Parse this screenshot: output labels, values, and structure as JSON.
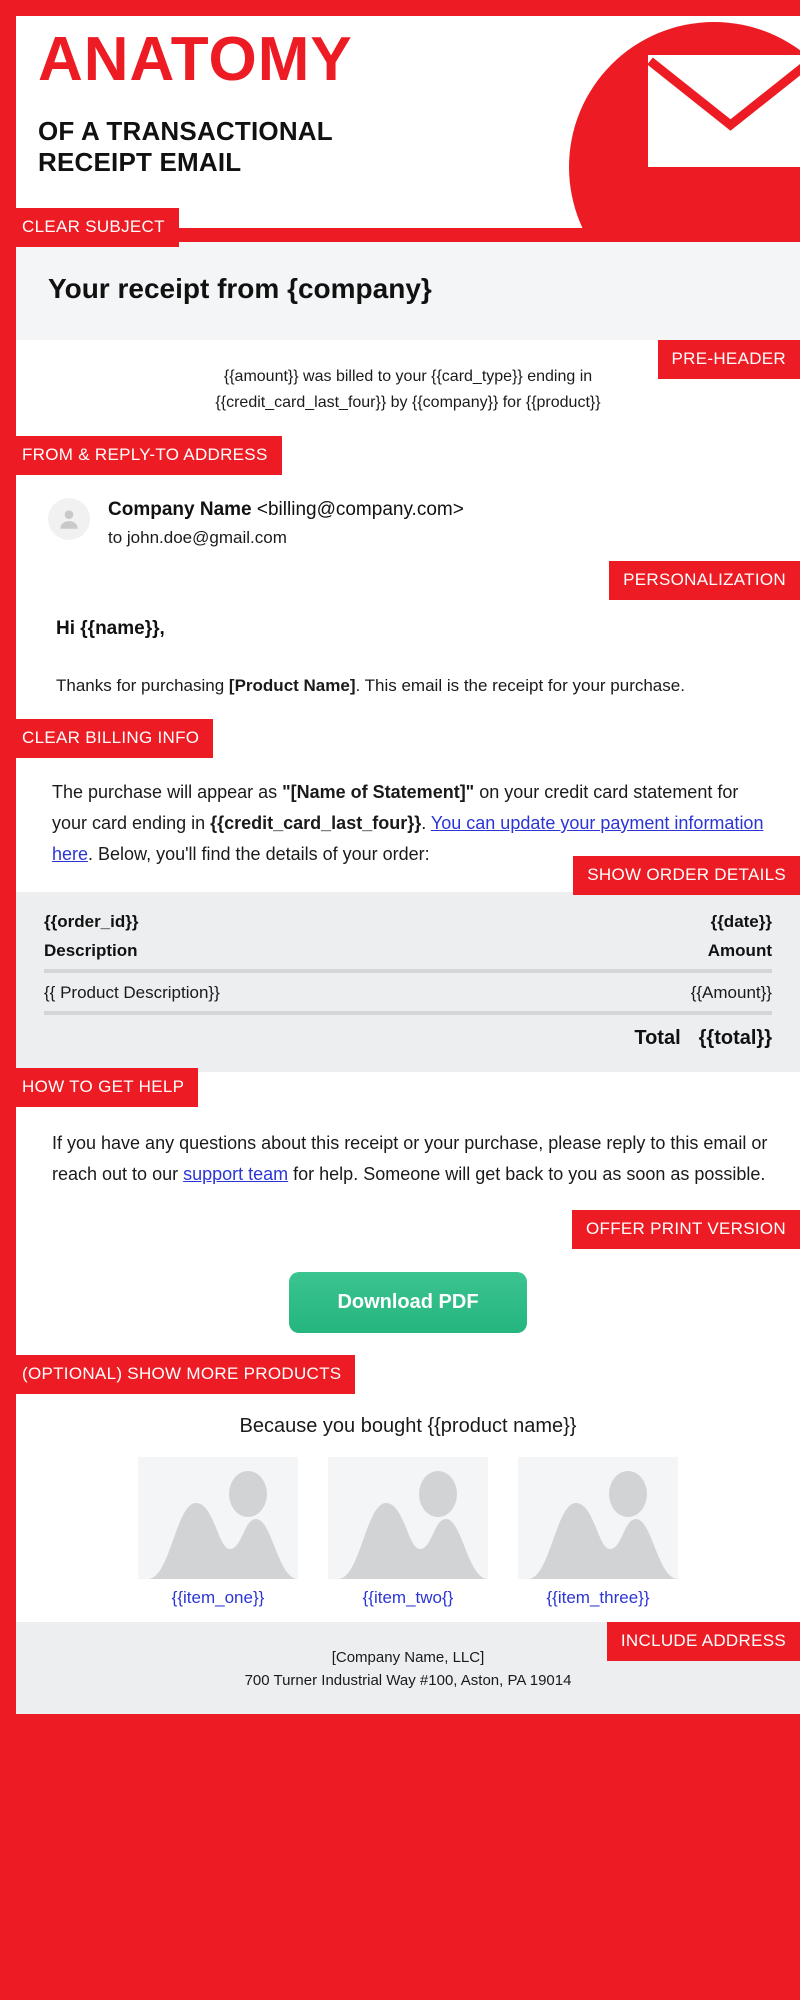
{
  "header": {
    "title_main": "ANATOMY",
    "title_sub_line1": "OF A TRANSACTIONAL",
    "title_sub_line2": "RECEIPT EMAIL",
    "envelope_icon": "envelope-icon",
    "brand_red": "#ED1C24"
  },
  "tags": {
    "clear_subject": "CLEAR SUBJECT",
    "pre_header": "PRE-HEADER",
    "from_reply_to": "FROM & REPLY-TO ADDRESS",
    "personalization": "PERSONALIZATION",
    "clear_billing_info": "CLEAR BILLING INFO",
    "show_order_details": "SHOW ORDER DETAILS",
    "how_to_get_help": "HOW TO GET HELP",
    "offer_print_version": "OFFER PRINT VERSION",
    "show_more_products": "(OPTIONAL) SHOW MORE PRODUCTS",
    "include_address": "INCLUDE ADDRESS"
  },
  "subject": {
    "text": "Your receipt from {company}"
  },
  "preheader": {
    "line1": "{{amount}} was billed to your {{card_type}} ending in",
    "line2": "{{credit_card_last_four}} by {{company}} for {{product}}"
  },
  "from": {
    "avatar_icon": "person-avatar-icon",
    "sender_name": "Company Name",
    "sender_email": "<billing@company.com>",
    "recipient_line": "to john.doe@gmail.com"
  },
  "greeting": {
    "text": "Hi {{name}},"
  },
  "thanks": {
    "prefix": "Thanks for purchasing ",
    "product": "[Product Name]",
    "suffix": ". This email is the receipt for your purchase."
  },
  "billing": {
    "part1": "The purchase will appear as ",
    "statement_name": "\"[Name of Statement]\"",
    "part2": " on your credit card statement for your card ending in ",
    "card_last_four": "{{credit_card_last_four}}",
    "part3": ". ",
    "link_text": "You can update your payment information here",
    "part4": ". Below, you'll find the details of your order:"
  },
  "order": {
    "order_id": "{{order_id}}",
    "date": "{{date}}",
    "col_description": "Description",
    "col_amount": "Amount",
    "rows": [
      {
        "description": "{{ Product Description}}",
        "amount": "{{Amount}}"
      }
    ],
    "total_label": "Total",
    "total_value": "{{total}}"
  },
  "help": {
    "part1": "If you have any questions about this receipt or your purchase, please reply to this email or reach out to our ",
    "link_text": "support team",
    "part2": " for help. Someone will get back to you as soon as possible."
  },
  "cta": {
    "button_label": "Download PDF",
    "button_color": "#2FBC86"
  },
  "products": {
    "title": "Because you bought {{product name}}",
    "items": [
      {
        "label": "{{item_one}}",
        "thumb_icon": "image-placeholder-icon"
      },
      {
        "label": "{{item_two{}",
        "thumb_icon": "image-placeholder-icon"
      },
      {
        "label": "{{item_three}}",
        "thumb_icon": "image-placeholder-icon"
      }
    ]
  },
  "footer": {
    "company": "[Company Name, LLC]",
    "address": "700 Turner Industrial Way #100, Aston, PA 19014"
  }
}
